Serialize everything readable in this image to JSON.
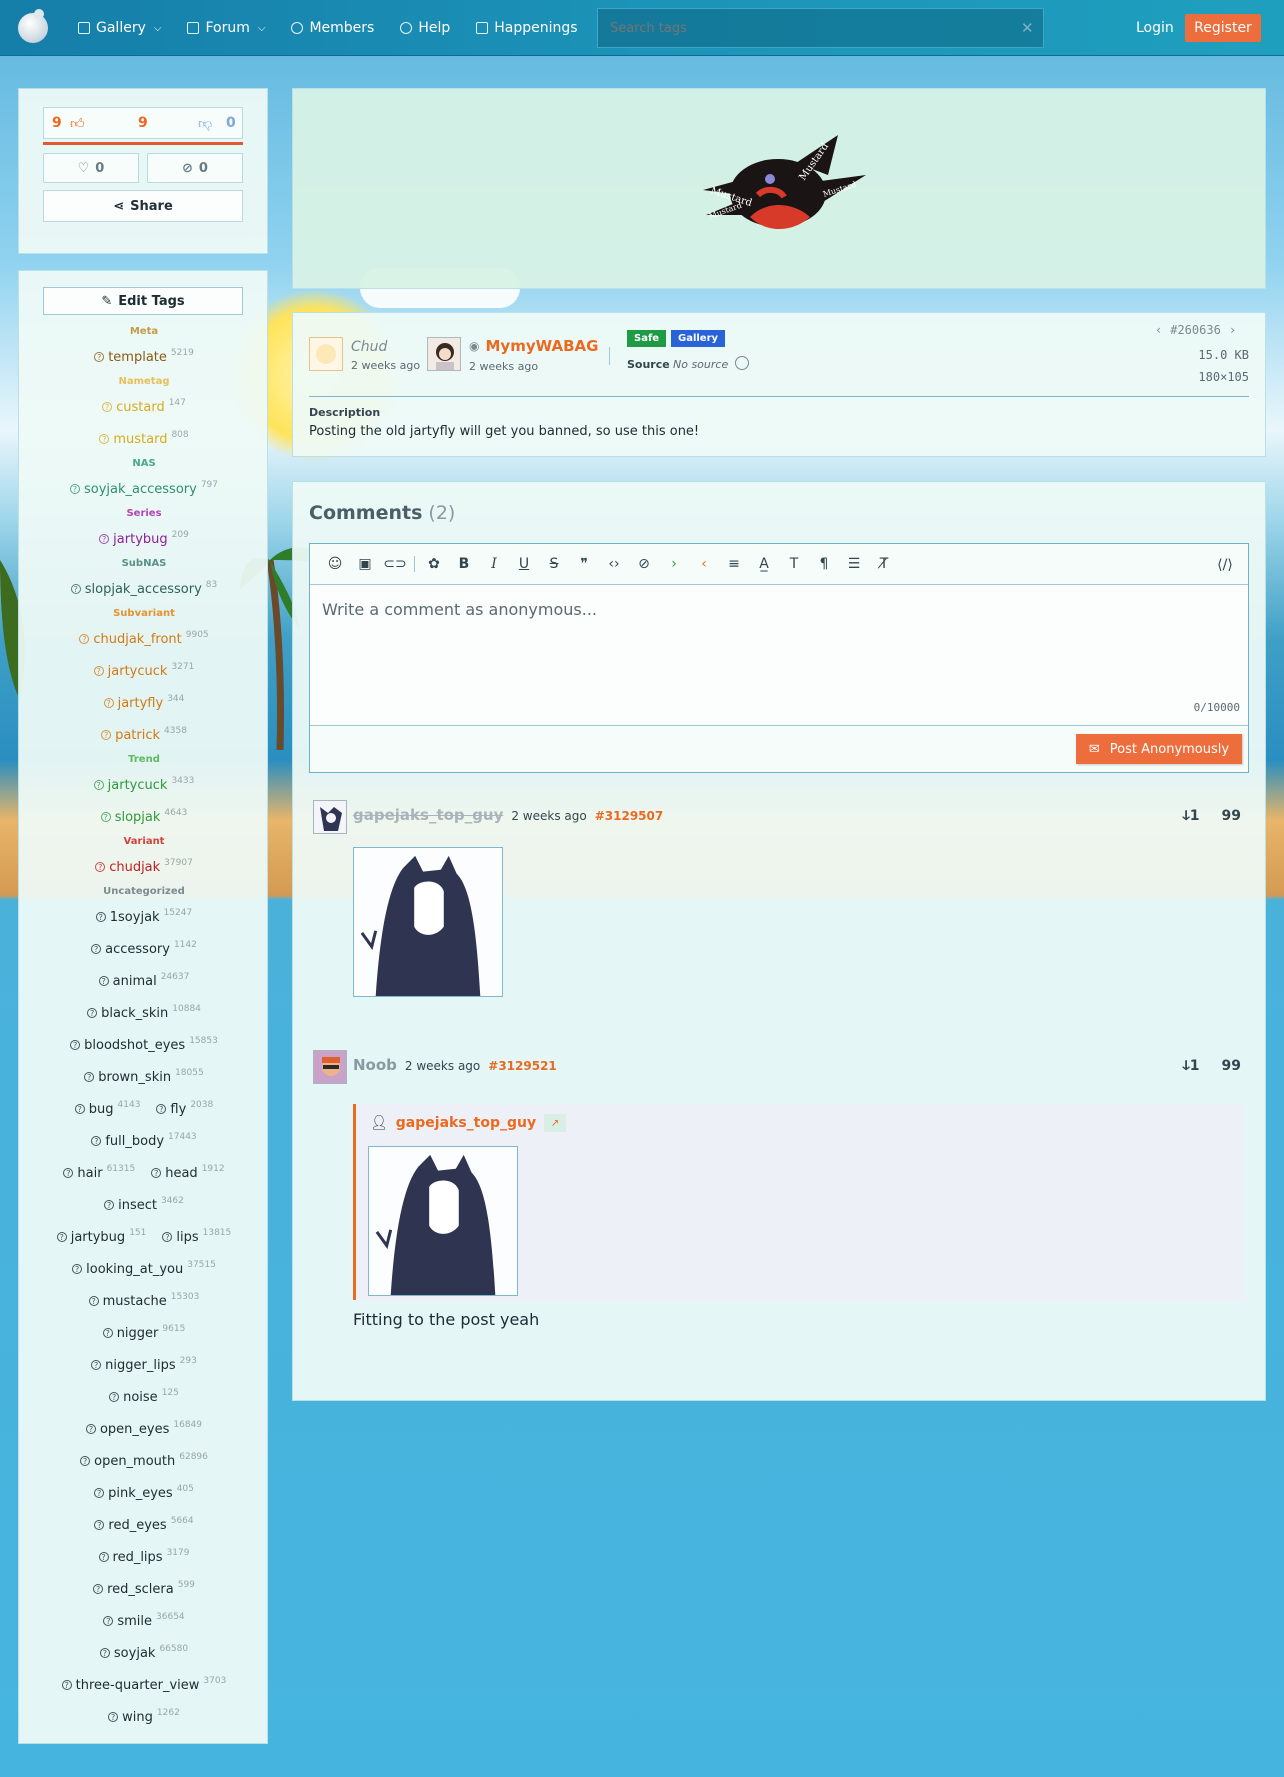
{
  "nav": {
    "items": [
      {
        "label": "Gallery",
        "icon": "image-icon",
        "dropdown": true
      },
      {
        "label": "Forum",
        "icon": "chat-icon",
        "dropdown": true
      },
      {
        "label": "Members",
        "icon": "user-icon",
        "dropdown": false
      },
      {
        "label": "Help",
        "icon": "help-icon",
        "dropdown": false
      },
      {
        "label": "Happenings",
        "icon": "book-icon",
        "dropdown": false
      }
    ],
    "search_placeholder": "Search tags",
    "login": "Login",
    "register": "Register"
  },
  "votes": {
    "up": "9",
    "score": "9",
    "down": "0",
    "favorites": "0",
    "hides": "0",
    "share": "Share"
  },
  "tags": {
    "edit_label": "Edit Tags",
    "rows": [
      {
        "category": "Meta",
        "color": "#c79a4a"
      },
      {
        "tags": [
          {
            "name": "template",
            "count": "5219",
            "color": "#8a5a12"
          }
        ]
      },
      {
        "category": "Nametag",
        "color": "#e6c15a"
      },
      {
        "tags": [
          {
            "name": "custard",
            "count": "147",
            "color": "#d9aa1c"
          }
        ]
      },
      {
        "tags": [
          {
            "name": "mustard",
            "count": "808",
            "color": "#d9aa1c"
          }
        ]
      },
      {
        "category": "NAS",
        "color": "#4aa88a"
      },
      {
        "tags": [
          {
            "name": "soyjak_accessory",
            "count": "797",
            "color": "#2f8f70"
          }
        ]
      },
      {
        "category": "Series",
        "color": "#b246b8"
      },
      {
        "tags": [
          {
            "name": "jartybug",
            "count": "209",
            "color": "#8e1f96"
          }
        ]
      },
      {
        "category": "SubNAS",
        "color": "#5b8f8a"
      },
      {
        "tags": [
          {
            "name": "slopjak_accessory",
            "count": "83",
            "color": "#2f5f5a"
          }
        ]
      },
      {
        "category": "Subvariant",
        "color": "#e5922f"
      },
      {
        "tags": [
          {
            "name": "chudjak_front",
            "count": "9905",
            "color": "#d37a10"
          }
        ]
      },
      {
        "tags": [
          {
            "name": "jartycuck",
            "count": "3271",
            "color": "#d37a10"
          }
        ]
      },
      {
        "tags": [
          {
            "name": "jartyfly",
            "count": "344",
            "color": "#d37a10"
          }
        ]
      },
      {
        "tags": [
          {
            "name": "patrick",
            "count": "4358",
            "color": "#d37a10"
          }
        ]
      },
      {
        "category": "Trend",
        "color": "#5dba5d"
      },
      {
        "tags": [
          {
            "name": "jartycuck",
            "count": "3433",
            "color": "#2f9a3a"
          }
        ]
      },
      {
        "tags": [
          {
            "name": "slopjak",
            "count": "4643",
            "color": "#2f9a3a"
          }
        ]
      },
      {
        "category": "Variant",
        "color": "#d2423a"
      },
      {
        "tags": [
          {
            "name": "chudjak",
            "count": "37907",
            "color": "#c21f1f"
          }
        ]
      },
      {
        "category": "Uncategorized",
        "color": "#7a8a92"
      },
      {
        "tags": [
          {
            "name": "1soyjak",
            "count": "15247",
            "color": "#1d2b33"
          }
        ]
      },
      {
        "tags": [
          {
            "name": "accessory",
            "count": "1142",
            "color": "#1d2b33"
          }
        ]
      },
      {
        "tags": [
          {
            "name": "animal",
            "count": "24637",
            "color": "#1d2b33"
          }
        ]
      },
      {
        "tags": [
          {
            "name": "black_skin",
            "count": "10884",
            "color": "#1d2b33"
          }
        ]
      },
      {
        "tags": [
          {
            "name": "bloodshot_eyes",
            "count": "15853",
            "color": "#1d2b33"
          }
        ]
      },
      {
        "tags": [
          {
            "name": "brown_skin",
            "count": "18055",
            "color": "#1d2b33"
          }
        ]
      },
      {
        "tags": [
          {
            "name": "bug",
            "count": "4143",
            "color": "#1d2b33"
          },
          {
            "name": "fly",
            "count": "2038",
            "color": "#1d2b33"
          }
        ]
      },
      {
        "tags": [
          {
            "name": "full_body",
            "count": "17443",
            "color": "#1d2b33"
          }
        ]
      },
      {
        "tags": [
          {
            "name": "hair",
            "count": "61315",
            "color": "#1d2b33"
          },
          {
            "name": "head",
            "count": "1912",
            "color": "#1d2b33"
          }
        ]
      },
      {
        "tags": [
          {
            "name": "insect",
            "count": "3462",
            "color": "#1d2b33"
          }
        ]
      },
      {
        "tags": [
          {
            "name": "jartybug",
            "count": "151",
            "color": "#1d2b33"
          },
          {
            "name": "lips",
            "count": "13815",
            "color": "#1d2b33"
          }
        ]
      },
      {
        "tags": [
          {
            "name": "looking_at_you",
            "count": "37515",
            "color": "#1d2b33"
          }
        ]
      },
      {
        "tags": [
          {
            "name": "mustache",
            "count": "15303",
            "color": "#1d2b33"
          }
        ]
      },
      {
        "tags": [
          {
            "name": "nigger",
            "count": "9615",
            "color": "#1d2b33"
          }
        ]
      },
      {
        "tags": [
          {
            "name": "nigger_lips",
            "count": "293",
            "color": "#1d2b33"
          }
        ]
      },
      {
        "tags": [
          {
            "name": "noise",
            "count": "125",
            "color": "#1d2b33"
          }
        ]
      },
      {
        "tags": [
          {
            "name": "open_eyes",
            "count": "16849",
            "color": "#1d2b33"
          }
        ]
      },
      {
        "tags": [
          {
            "name": "open_mouth",
            "count": "62896",
            "color": "#1d2b33"
          }
        ]
      },
      {
        "tags": [
          {
            "name": "pink_eyes",
            "count": "405",
            "color": "#1d2b33"
          }
        ]
      },
      {
        "tags": [
          {
            "name": "red_eyes",
            "count": "5664",
            "color": "#1d2b33"
          }
        ]
      },
      {
        "tags": [
          {
            "name": "red_lips",
            "count": "3179",
            "color": "#1d2b33"
          }
        ]
      },
      {
        "tags": [
          {
            "name": "red_sclera",
            "count": "599",
            "color": "#1d2b33"
          }
        ]
      },
      {
        "tags": [
          {
            "name": "smile",
            "count": "36654",
            "color": "#1d2b33"
          }
        ]
      },
      {
        "tags": [
          {
            "name": "soyjak",
            "count": "66580",
            "color": "#1d2b33"
          }
        ]
      },
      {
        "tags": [
          {
            "name": "three-quarter_view",
            "count": "3703",
            "color": "#1d2b33"
          }
        ]
      },
      {
        "tags": [
          {
            "name": "wing",
            "count": "1262",
            "color": "#1d2b33"
          }
        ]
      }
    ]
  },
  "post": {
    "image_text": [
      "Mustard",
      "Mustard",
      "Mustard",
      "Mustard"
    ],
    "uploader": {
      "name": "Chud",
      "time": "2 weeks ago"
    },
    "approver": {
      "name": "MymyWABAG",
      "time": "2 weeks ago"
    },
    "badges": [
      {
        "label": "Safe",
        "color": "#1f9a45"
      },
      {
        "label": "Gallery",
        "color": "#2a63d8"
      }
    ],
    "source_label": "Source",
    "source_value": "No source",
    "id": "#260636",
    "filesize": "15.0 KB",
    "dimensions": "180×105",
    "description_label": "Description",
    "description": "Posting the old jartyfly will get you banned, so use this one!"
  },
  "comments": {
    "title": "Comments",
    "count": "(2)",
    "placeholder": "Write a comment as anonymous...",
    "char_count": "0/10000",
    "post_button": "Post Anonymously",
    "items": [
      {
        "author": "gapejaks_top_guy",
        "time": "2 weeks ago",
        "id": "#3129507"
      },
      {
        "author": "Noob",
        "time": "2 weeks ago",
        "id": "#3129521",
        "quote_author": "gapejaks_top_guy",
        "quote_link": "↗",
        "text": "Fitting to the post yeah"
      }
    ],
    "actions": {
      "reply": "ↆ1",
      "quote": "99"
    }
  }
}
